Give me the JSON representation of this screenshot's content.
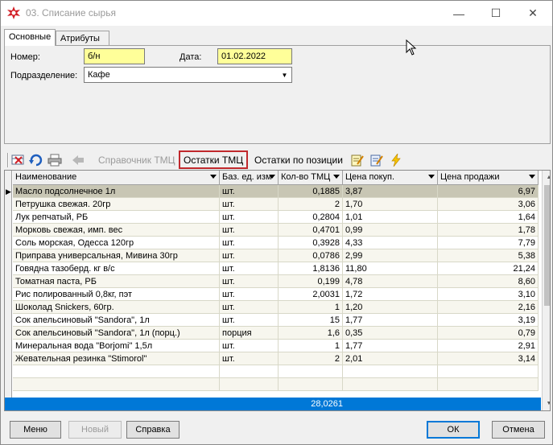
{
  "window": {
    "title": "03. Списание сырья",
    "minimize_glyph": "—",
    "maximize_glyph": "☐",
    "close_glyph": "✕"
  },
  "tabs": [
    {
      "label": "Основные",
      "active": true
    },
    {
      "label": "Атрибуты",
      "active": false
    }
  ],
  "form": {
    "number_label": "Номер:",
    "number_value": "б/н",
    "date_label": "Дата:",
    "date_value": "01.02.2022",
    "dept_label": "Подразделение:",
    "dept_value": "Кафе"
  },
  "toolbar": {
    "icons": [
      "delete-row-icon",
      "refresh-icon",
      "print-icon",
      "import-icon"
    ],
    "catalog_label": "Справочник ТМЦ",
    "stock_label": "Остатки ТМЦ",
    "stock_by_position_label": "Остатки по позиции",
    "extra_icons": [
      "edit-note-icon",
      "edit-list-icon",
      "lightning-icon"
    ]
  },
  "grid": {
    "columns": [
      {
        "label": "Наименование"
      },
      {
        "label": "Баз. ед. изм"
      },
      {
        "label": "Кол-во ТМЦ"
      },
      {
        "label": "Цена покуп."
      },
      {
        "label": "Цена продажи"
      }
    ],
    "rows": [
      {
        "name": "Масло подсолнечное 1л",
        "unit": "шт.",
        "qty": "0,1885",
        "buy": "3,87",
        "sell": "6,97"
      },
      {
        "name": "Петрушка свежая. 20гр",
        "unit": "шт.",
        "qty": "2",
        "buy": "1,70",
        "sell": "3,06"
      },
      {
        "name": "Лук репчатый, РБ",
        "unit": "шт.",
        "qty": "0,2804",
        "buy": "1,01",
        "sell": "1,64"
      },
      {
        "name": "Морковь свежая, имп. вес",
        "unit": "шт.",
        "qty": "0,4701",
        "buy": "0,99",
        "sell": "1,78"
      },
      {
        "name": "Соль морская, Одесса 120гр",
        "unit": "шт.",
        "qty": "0,3928",
        "buy": "4,33",
        "sell": "7,79"
      },
      {
        "name": "Приправа универсальная, Мивина 30гр",
        "unit": "шт.",
        "qty": "0,0786",
        "buy": "2,99",
        "sell": "5,38"
      },
      {
        "name": "Говядна тазоберд. кг в/с",
        "unit": "шт.",
        "qty": "1,8136",
        "buy": "11,80",
        "sell": "21,24"
      },
      {
        "name": "Томатная паста, РБ",
        "unit": "шт.",
        "qty": "0,199",
        "buy": "4,78",
        "sell": "8,60"
      },
      {
        "name": "Рис полированный 0,8кг, пэт",
        "unit": "шт.",
        "qty": "2,0031",
        "buy": "1,72",
        "sell": "3,10"
      },
      {
        "name": "Шоколад Snickers, 60гр.",
        "unit": "шт.",
        "qty": "1",
        "buy": "1,20",
        "sell": "2,16"
      },
      {
        "name": "Сок апельсиновый \"Sandora\", 1л",
        "unit": "шт.",
        "qty": "15",
        "buy": "1,77",
        "sell": "3,19"
      },
      {
        "name": "Сок апельсиновый \"Sandora\", 1л (порц.)",
        "unit": "порция",
        "qty": "1,6",
        "buy": "0,35",
        "sell": "0,79"
      },
      {
        "name": "Минеральная вода \"Borjomi\" 1,5л",
        "unit": "шт.",
        "qty": "1",
        "buy": "1,77",
        "sell": "2,91"
      },
      {
        "name": "Жевательная резинка \"Stimorol\"",
        "unit": "шт.",
        "qty": "2",
        "buy": "2,01",
        "sell": "3,14"
      }
    ],
    "total_qty": "28,0261"
  },
  "buttons": {
    "menu": "Меню",
    "new": "Новый",
    "help": "Справка",
    "ok": "ОК",
    "cancel": "Отмена"
  },
  "colors": {
    "highlight_border": "#c0282c",
    "yellow_field": "#ffff99",
    "selected_row": "#c8c6b4",
    "footer": "#0078d7"
  }
}
